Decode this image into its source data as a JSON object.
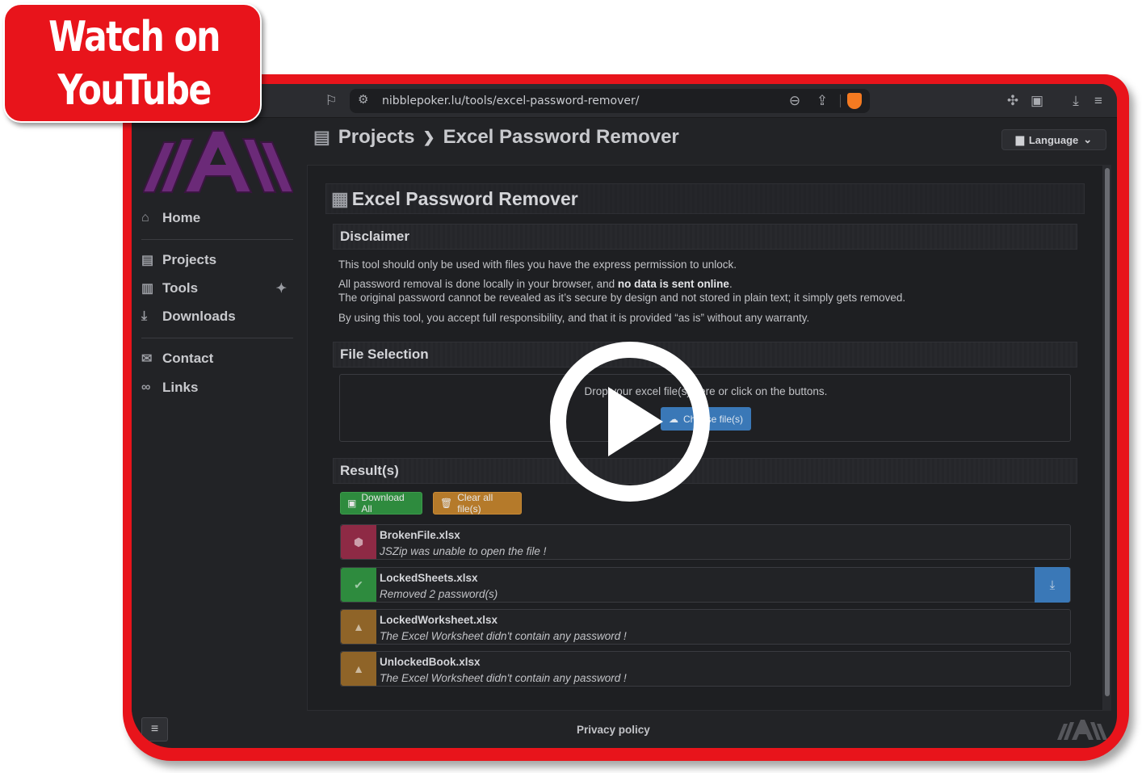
{
  "browser": {
    "url": "nibblepoker.lu/tools/excel-password-remover/",
    "icons": [
      "bookmark-icon",
      "site-settings-icon",
      "zoom-out-icon",
      "share-icon",
      "brave-shield-icon",
      "extensions-icon",
      "reader-icon",
      "download-icon",
      "menu-icon"
    ]
  },
  "sidebar": {
    "items": [
      {
        "label": "Home",
        "icon": "home-icon"
      },
      {
        "label": "Projects",
        "icon": "briefcase-icon"
      },
      {
        "label": "Tools",
        "icon": "toolbox-icon"
      },
      {
        "label": "Downloads",
        "icon": "download-icon"
      },
      {
        "label": "Contact",
        "icon": "mail-icon"
      },
      {
        "label": "Links",
        "icon": "link-icon"
      }
    ]
  },
  "header": {
    "crumb_1": "Projects",
    "separator": "❯",
    "crumb_2": "Excel Password Remover",
    "language_label": "Language"
  },
  "tool": {
    "title": "Excel Password Remover",
    "disclaimer_heading": "Disclaimer",
    "disclaimer_line_1": "This tool should only be used with files you have the express permission to unlock.",
    "disclaimer_line_2a": "All password removal is done locally in your browser, and ",
    "disclaimer_line_2b": "no data is sent online",
    "disclaimer_line_2c": ".",
    "disclaimer_line_3": "The original password cannot be revealed as it’s secure by design and not stored in plain text; it simply gets removed.",
    "disclaimer_line_4": "By using this tool, you accept full responsibility, and that it is provided “as is” without any warranty.",
    "file_heading": "File Selection",
    "drop_text": "Drop your excel file(s) here or click on the buttons.",
    "choose_label": "Choose file(s)",
    "results_heading": "Result(s)",
    "download_all_label": "Download All",
    "clear_label": "Clear all file(s)"
  },
  "results": [
    {
      "file": "BrokenFile.xlsx",
      "message": "JSZip was unable to open the file !",
      "status": "error",
      "color": "#8e2a45"
    },
    {
      "file": "LockedSheets.xlsx",
      "message": "Removed 2 password(s)",
      "status": "success",
      "color": "#2e8b3e"
    },
    {
      "file": "LockedWorksheet.xlsx",
      "message": "The Excel Worksheet didn't contain any password !",
      "status": "warning",
      "color": "#8f6428"
    },
    {
      "file": "UnlockedBook.xlsx",
      "message": "The Excel Worksheet didn't contain any password !",
      "status": "warning",
      "color": "#8f6428"
    }
  ],
  "footer": {
    "privacy_label": "Privacy policy"
  },
  "overlay": {
    "youtube_line_1": "Watch on",
    "youtube_line_2": "YouTube"
  },
  "colors": {
    "frame": "#e8141b",
    "accent_blue": "#3a78b7",
    "accent_green": "#2e8b3e",
    "accent_orange": "#b57a2a",
    "logo_purple": "#6b2a78"
  }
}
